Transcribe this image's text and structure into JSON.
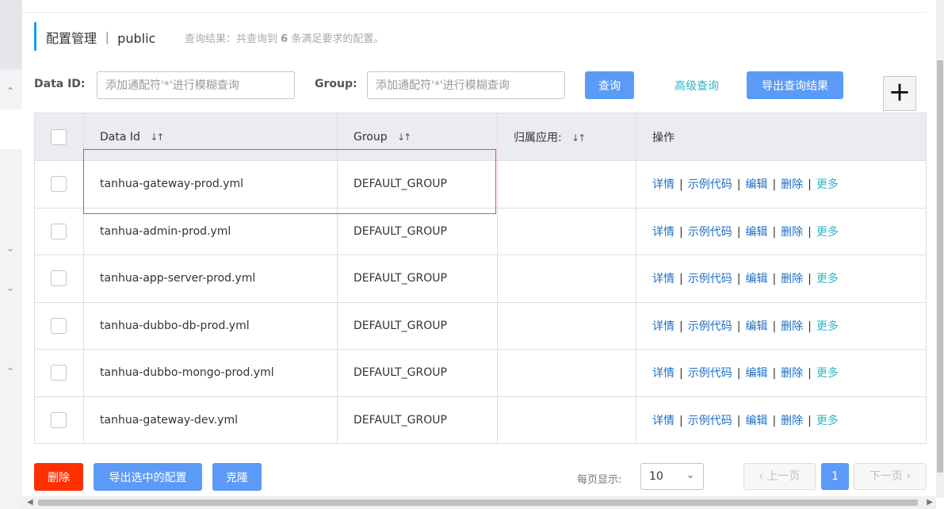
{
  "header": {
    "title": "配置管理 ｜ public",
    "summary_prefix": "查询结果：共查询到",
    "summary_count": "6",
    "summary_suffix": "条满足要求的配置。"
  },
  "search": {
    "data_id_label": "Data ID:",
    "data_id_placeholder": "添加通配符'*'进行模糊查询",
    "group_label": "Group:",
    "group_placeholder": "添加通配符'*'进行模糊查询",
    "query_button": "查询",
    "advanced_query": "高级查询",
    "export_results_button": "导出查询结果",
    "add_button": "+"
  },
  "table": {
    "columns": {
      "data_id": "Data Id",
      "group": "Group",
      "app": "归属应用:",
      "ops": "操作"
    },
    "op_labels": {
      "detail": "详情",
      "sample": "示例代码",
      "edit": "编辑",
      "delete": "删除",
      "more": "更多",
      "sep": "|"
    },
    "rows": [
      {
        "data_id": "tanhua-gateway-prod.yml",
        "group": "DEFAULT_GROUP",
        "app": ""
      },
      {
        "data_id": "tanhua-admin-prod.yml",
        "group": "DEFAULT_GROUP",
        "app": ""
      },
      {
        "data_id": "tanhua-app-server-prod.yml",
        "group": "DEFAULT_GROUP",
        "app": ""
      },
      {
        "data_id": "tanhua-dubbo-db-prod.yml",
        "group": "DEFAULT_GROUP",
        "app": ""
      },
      {
        "data_id": "tanhua-dubbo-mongo-prod.yml",
        "group": "DEFAULT_GROUP",
        "app": ""
      },
      {
        "data_id": "tanhua-gateway-dev.yml",
        "group": "DEFAULT_GROUP",
        "app": ""
      }
    ]
  },
  "footer": {
    "delete_button": "删除",
    "export_selected_button": "导出选中的配置",
    "clone_button": "克隆",
    "per_page_label": "每页显示:",
    "per_page_value": "10",
    "prev_page": "上一页",
    "current_page": "1",
    "next_page": "下一页"
  },
  "colors": {
    "primary": "#5b9bf7",
    "danger": "#ff3000",
    "link": "#1c6fc6",
    "more_link": "#2cb5c9",
    "highlight_box": "#e74c4c"
  }
}
